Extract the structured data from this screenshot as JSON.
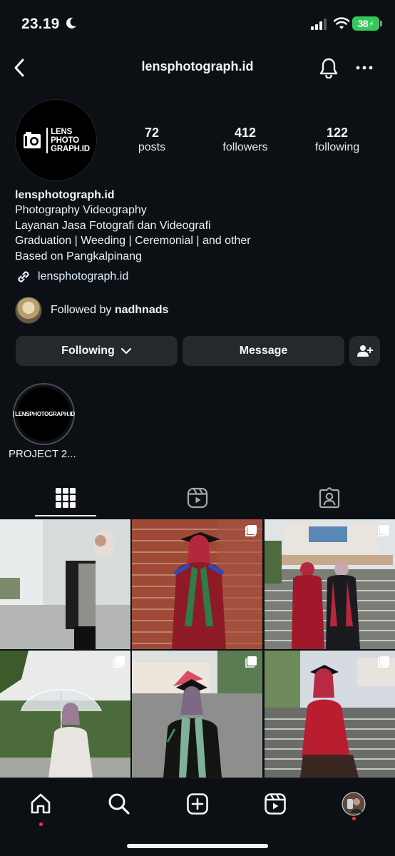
{
  "status_bar": {
    "time": "23.19",
    "battery": "38"
  },
  "header": {
    "title": "lensphotograph.id",
    "icons": [
      "back-icon",
      "bell-icon",
      "more-icon"
    ]
  },
  "profile": {
    "logo_text": [
      "LENS",
      "PHOTO",
      "GRAPH.ID"
    ],
    "stats": [
      {
        "value": "72",
        "label": "posts"
      },
      {
        "value": "412",
        "label": "followers"
      },
      {
        "value": "122",
        "label": "following"
      }
    ],
    "name": "lensphotograph.id",
    "bio_lines": [
      "Photography Videography",
      "Layanan Jasa Fotografi dan Videografi",
      "Graduation | Weeding | Ceremonial | and other",
      "Based on Pangkalpinang"
    ],
    "link": "lensphotograph.id",
    "followed_by_prefix": "Followed by ",
    "followed_by_user": "nadhnads"
  },
  "actions": {
    "following_label": "Following",
    "message_label": "Message"
  },
  "highlights": [
    {
      "label": "PROJECT 2...",
      "logo_text": "LENSPHOTOGRAPH.ID"
    }
  ],
  "tabs": [
    "grid-icon",
    "reels-icon",
    "tagged-icon"
  ],
  "bottom_nav": [
    "home-icon",
    "search-icon",
    "create-icon",
    "reels-icon",
    "profile-avatar"
  ],
  "colors": {
    "background": "#0c1014",
    "button": "#25292e",
    "notification_dot": "#ff3040",
    "battery": "#35c759",
    "link": "#e0f1ff"
  }
}
